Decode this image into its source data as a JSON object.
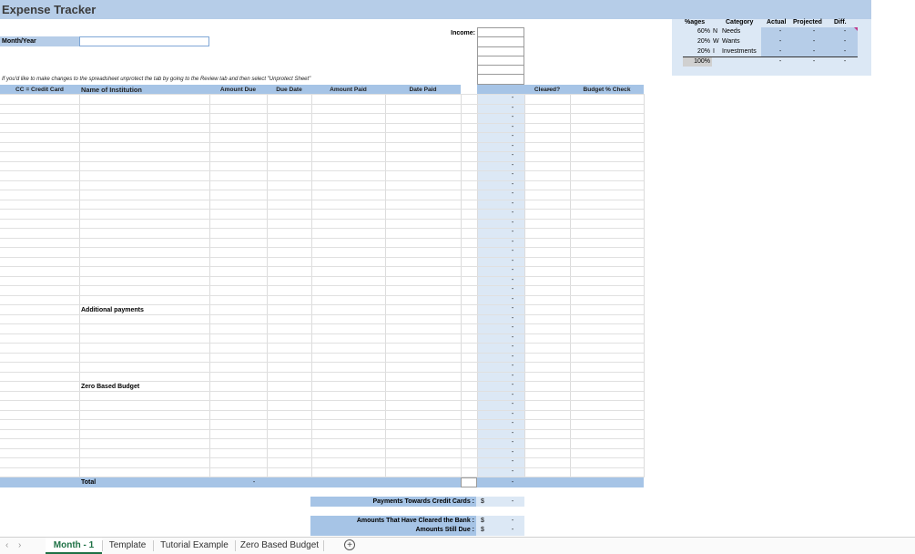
{
  "sheet": {
    "title": "Expense Tracker",
    "month_year_label": "Month/Year",
    "income_label": "Income:",
    "instruction": "If you'd like to make changes to the spreadsheet unprotect the tab by going to the Review tab and then select \"Unprotect Sheet\"",
    "columns": [
      "CC = Credit Card",
      "Name of Institution",
      "Amount Due",
      "Due Date",
      "Amount Paid",
      "Date Paid",
      "-",
      "Cleared?",
      "Budget % Check"
    ],
    "additional_payments": "Additional payments",
    "zero_based_budget": "Zero Based Budget",
    "total_label": "Total",
    "total_amount": "-",
    "total_col_dash": "-",
    "payments_cc_label": "Payments Towards Credit Cards :",
    "cleared_label": "Amounts That Have Cleared the Bank :",
    "still_due_label": "Amounts Still Due :",
    "currency": "$",
    "dash": "-"
  },
  "budget_table": {
    "headers": [
      "%ages",
      "Category",
      "Actual",
      "Projected",
      "Diff."
    ],
    "rows": [
      {
        "pct": "60%",
        "code": "N",
        "name": "Needs",
        "actual": "-",
        "projected": "-",
        "diff": "-"
      },
      {
        "pct": "20%",
        "code": "W",
        "name": "Wants",
        "actual": "-",
        "projected": "-",
        "diff": "-"
      },
      {
        "pct": "20%",
        "code": "I",
        "name": "Investments",
        "actual": "-",
        "projected": "-",
        "diff": "-"
      }
    ],
    "total_pct": "100%",
    "total_actual": "-",
    "total_projected": "-",
    "total_diff": "-"
  },
  "tabs": [
    "Month - 1",
    "Template",
    "Tutorial Example",
    "Zero Based Budget"
  ],
  "nav": {
    "prev": "‹",
    "next": "›",
    "add": "+"
  },
  "colors": {
    "header_blue": "#a6c4e6",
    "title_blue": "#b6cde8",
    "light_blue": "#dce8f5",
    "tab_green": "#1e7145"
  }
}
